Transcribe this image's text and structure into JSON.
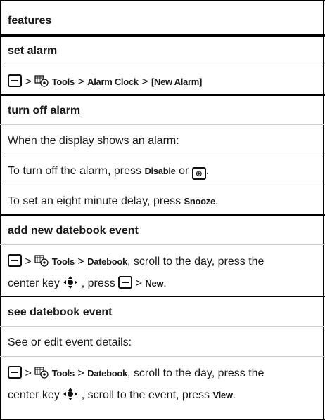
{
  "header": {
    "title": "features"
  },
  "sections": [
    {
      "heading": "set alarm",
      "path": {
        "sep1": ">",
        "tools": "Tools",
        "sep2": ">",
        "alarm_clock": "Alarm Clock",
        "sep3": ">",
        "new_alarm": "[New Alarm]"
      }
    },
    {
      "heading": "turn off alarm",
      "intro": "When the display shows an alarm:",
      "line1": {
        "pre": "To turn off the alarm, press ",
        "disable": "Disable",
        "or": " or ",
        "end": "."
      },
      "line2": {
        "pre": "To set an eight minute delay, press ",
        "snooze": "Snooze",
        "end": "."
      }
    },
    {
      "heading": "add new datebook event",
      "line1": {
        "sep1": " > ",
        "tools": "Tools",
        "sep2": " > ",
        "datebook": "Datebook",
        "rest": ", scroll to the day, press the"
      },
      "line2": {
        "pre": "center key ",
        "mid": ", press ",
        "sep": " > ",
        "new": "New",
        "end": "."
      }
    },
    {
      "heading": "see datebook event",
      "intro": "See or edit event details:",
      "line1": {
        "sep1": " > ",
        "tools": "Tools",
        "sep2": " > ",
        "datebook": "Datebook",
        "rest": ", scroll to the day, press the"
      },
      "line2": {
        "pre": "center key ",
        "mid": ", scroll to the event, press ",
        "view": "View",
        "end": "."
      }
    }
  ],
  "icons": {
    "menu_key": "menu-key-icon",
    "tools": "tools-icon",
    "power_key": "power-key-icon",
    "nav_key": "nav-center-key-icon"
  },
  "power_glyph": "⊕"
}
